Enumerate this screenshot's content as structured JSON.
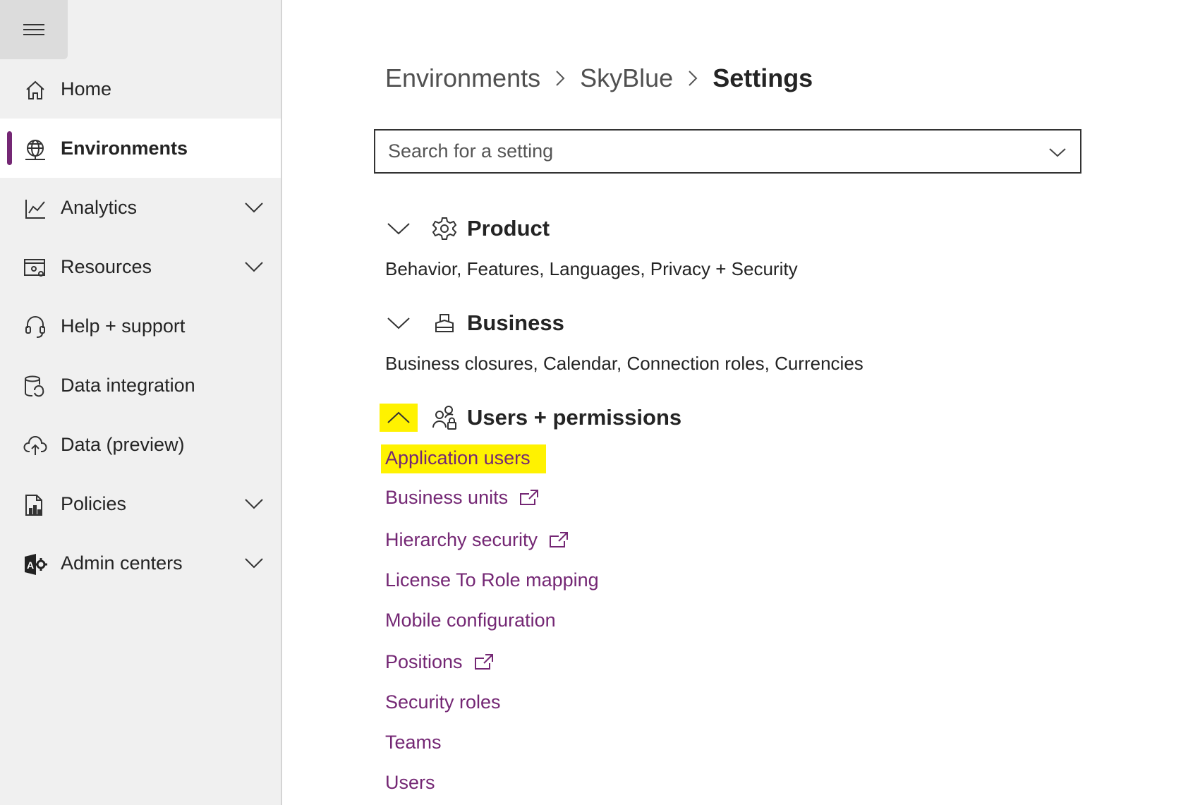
{
  "sidebar": {
    "items": [
      {
        "label": "Home",
        "icon": "home-icon",
        "active": false,
        "expandable": false
      },
      {
        "label": "Environments",
        "icon": "globe-icon",
        "active": true,
        "expandable": false
      },
      {
        "label": "Analytics",
        "icon": "chart-icon",
        "active": false,
        "expandable": true
      },
      {
        "label": "Resources",
        "icon": "resources-icon",
        "active": false,
        "expandable": true
      },
      {
        "label": "Help + support",
        "icon": "headset-icon",
        "active": false,
        "expandable": false
      },
      {
        "label": "Data integration",
        "icon": "data-integration-icon",
        "active": false,
        "expandable": false
      },
      {
        "label": "Data (preview)",
        "icon": "cloud-icon",
        "active": false,
        "expandable": false
      },
      {
        "label": "Policies",
        "icon": "policy-icon",
        "active": false,
        "expandable": true
      },
      {
        "label": "Admin centers",
        "icon": "admin-icon",
        "active": false,
        "expandable": true
      }
    ],
    "accent_color": "#742774"
  },
  "breadcrumb": {
    "items": [
      "Environments",
      "SkyBlue",
      "Settings"
    ]
  },
  "search": {
    "placeholder": "Search for a setting"
  },
  "sections": {
    "product": {
      "title": "Product",
      "description": "Behavior, Features, Languages, Privacy + Security",
      "expanded": false
    },
    "business": {
      "title": "Business",
      "description": "Business closures, Calendar, Connection roles, Currencies",
      "expanded": false
    },
    "users": {
      "title": "Users + permissions",
      "expanded": true,
      "links": [
        {
          "label": "Application users",
          "external": false,
          "highlighted": true
        },
        {
          "label": "Business units",
          "external": true,
          "highlighted": false
        },
        {
          "label": "Hierarchy security",
          "external": true,
          "highlighted": false
        },
        {
          "label": "License To Role mapping",
          "external": false,
          "highlighted": false
        },
        {
          "label": "Mobile configuration",
          "external": false,
          "highlighted": false
        },
        {
          "label": "Positions",
          "external": true,
          "highlighted": false
        },
        {
          "label": "Security roles",
          "external": false,
          "highlighted": false
        },
        {
          "label": "Teams",
          "external": false,
          "highlighted": false
        },
        {
          "label": "Users",
          "external": false,
          "highlighted": false
        }
      ]
    }
  },
  "colors": {
    "link": "#742774",
    "highlight": "#fff200"
  }
}
